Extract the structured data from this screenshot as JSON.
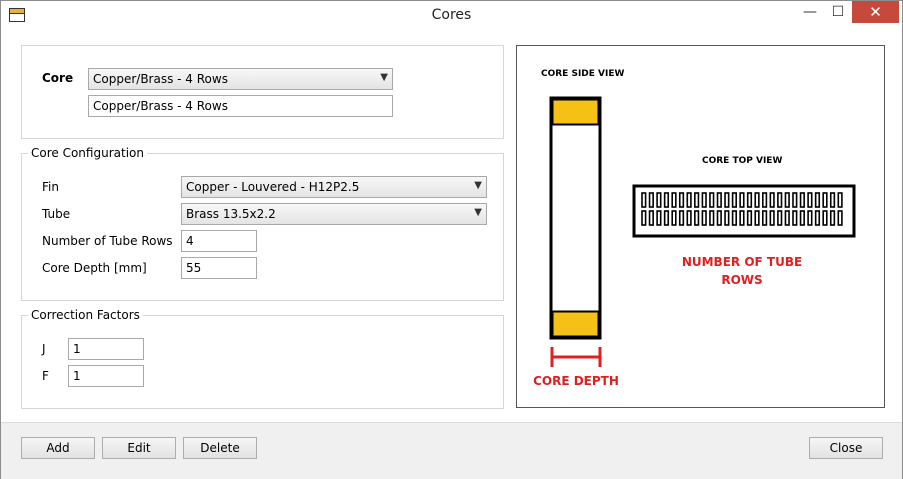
{
  "window": {
    "title": "Cores",
    "minimize": "—",
    "maximize": "☐",
    "close": "✕"
  },
  "core": {
    "label": "Core",
    "selected": "Copper/Brass - 4 Rows",
    "name_value": "Copper/Brass - 4 Rows"
  },
  "core_configuration": {
    "legend": "Core Configuration",
    "fin_label": "Fin",
    "fin_value": "Copper - Louvered - H12P2.5",
    "tube_label": "Tube",
    "tube_value": "Brass 13.5x2.2",
    "rows_label": "Number of Tube Rows",
    "rows_value": "4",
    "depth_label": "Core Depth [mm]",
    "depth_value": "55"
  },
  "correction_factors": {
    "legend": "Correction Factors",
    "j_label": "J",
    "j_value": "1",
    "f_label": "F",
    "f_value": "1"
  },
  "diagram": {
    "side_view_label": "CORE SIDE VIEW",
    "top_view_label": "CORE TOP VIEW",
    "rows_caption_line1": "NUMBER OF TUBE",
    "rows_caption_line2": "ROWS",
    "depth_caption": "CORE DEPTH",
    "tube_rows_shown": 2,
    "tubes_per_row": 27,
    "colors": {
      "accent_red": "#e02020",
      "header_yellow": "#f5c116"
    }
  },
  "buttons": {
    "add": "Add",
    "edit": "Edit",
    "delete": "Delete",
    "close": "Close"
  }
}
